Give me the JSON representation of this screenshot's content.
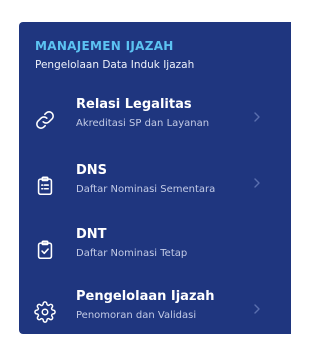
{
  "sidebar": {
    "section_title": "MANAJEMEN IJAZAH",
    "section_subtitle": "Pengelolaan Data Induk Ijazah",
    "colors": {
      "panel_bg": "#1f367f",
      "section_title": "#5cc3f2",
      "label": "#ffffff",
      "description": "#c3cbe6",
      "chevron": "#5a6fae"
    },
    "items": [
      {
        "label": "Relasi Legalitas",
        "description": "Akreditasi SP dan Layanan",
        "icon": "link-icon",
        "has_chevron": true
      },
      {
        "label": "DNS",
        "description": "Daftar Nominasi Sementara",
        "icon": "clipboard-list-icon",
        "has_chevron": true
      },
      {
        "label": "DNT",
        "description": "Daftar Nominasi Tetap",
        "icon": "clipboard-check-icon",
        "has_chevron": false
      },
      {
        "label": "Pengelolaan Ijazah",
        "description": "Penomoran dan Validasi",
        "icon": "gear-icon",
        "has_chevron": true
      }
    ]
  }
}
